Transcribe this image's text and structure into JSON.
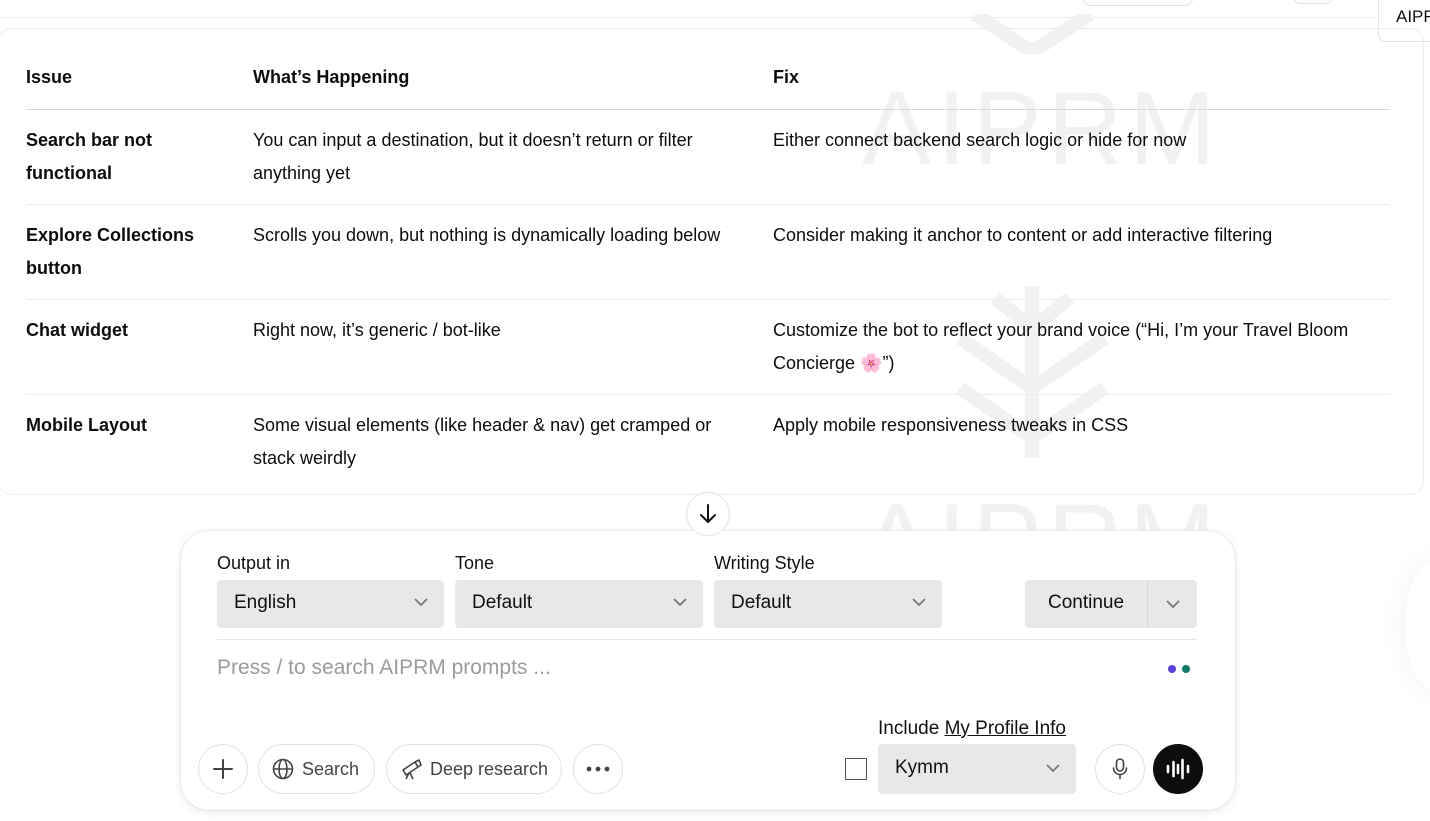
{
  "top_bar": {
    "aiprm_tab_label": "AIPRM"
  },
  "watermark": {
    "text": "AIPRM"
  },
  "table": {
    "headers": [
      "Issue",
      "What’s Happening",
      "Fix"
    ],
    "rows": [
      {
        "issue": "Search bar not functional",
        "happening": "You can input a destination, but it doesn’t return or filter anything yet",
        "fix": "Either connect backend search logic or hide for now"
      },
      {
        "issue": "Explore Collections button",
        "happening": "Scrolls you down, but nothing is dynamically loading below",
        "fix": "Consider making it anchor to content or add interactive filtering"
      },
      {
        "issue": "Chat widget",
        "happening": "Right now, it’s generic / bot-like",
        "fix": "Customize the bot to reflect your brand voice (“Hi, I’m your Travel Bloom Concierge 🌸”)"
      },
      {
        "issue": "Mobile Layout",
        "happening": "Some visual elements (like header & nav) get cramped or stack weirdly",
        "fix": "Apply mobile responsiveness tweaks in CSS"
      }
    ]
  },
  "composer": {
    "output_label": "Output in",
    "output_value": "English",
    "tone_label": "Tone",
    "tone_value": "Default",
    "style_label": "Writing Style",
    "style_value": "Default",
    "continue_label": "Continue",
    "prompt_placeholder": "Press / to search AIPRM prompts ...",
    "search_label": "Search",
    "deep_research_label": "Deep research",
    "include_prefix": "Include",
    "include_link": "My Profile Info",
    "profile_value": "Kymm",
    "dot_colors": [
      "#5b3fd9",
      "#0f7a6a"
    ]
  },
  "icons": [
    "arrow-down-icon",
    "chevron-down-icon",
    "plus-icon",
    "globe-icon",
    "telescope-icon",
    "more-icon",
    "mic-icon",
    "voice-wave-icon"
  ]
}
